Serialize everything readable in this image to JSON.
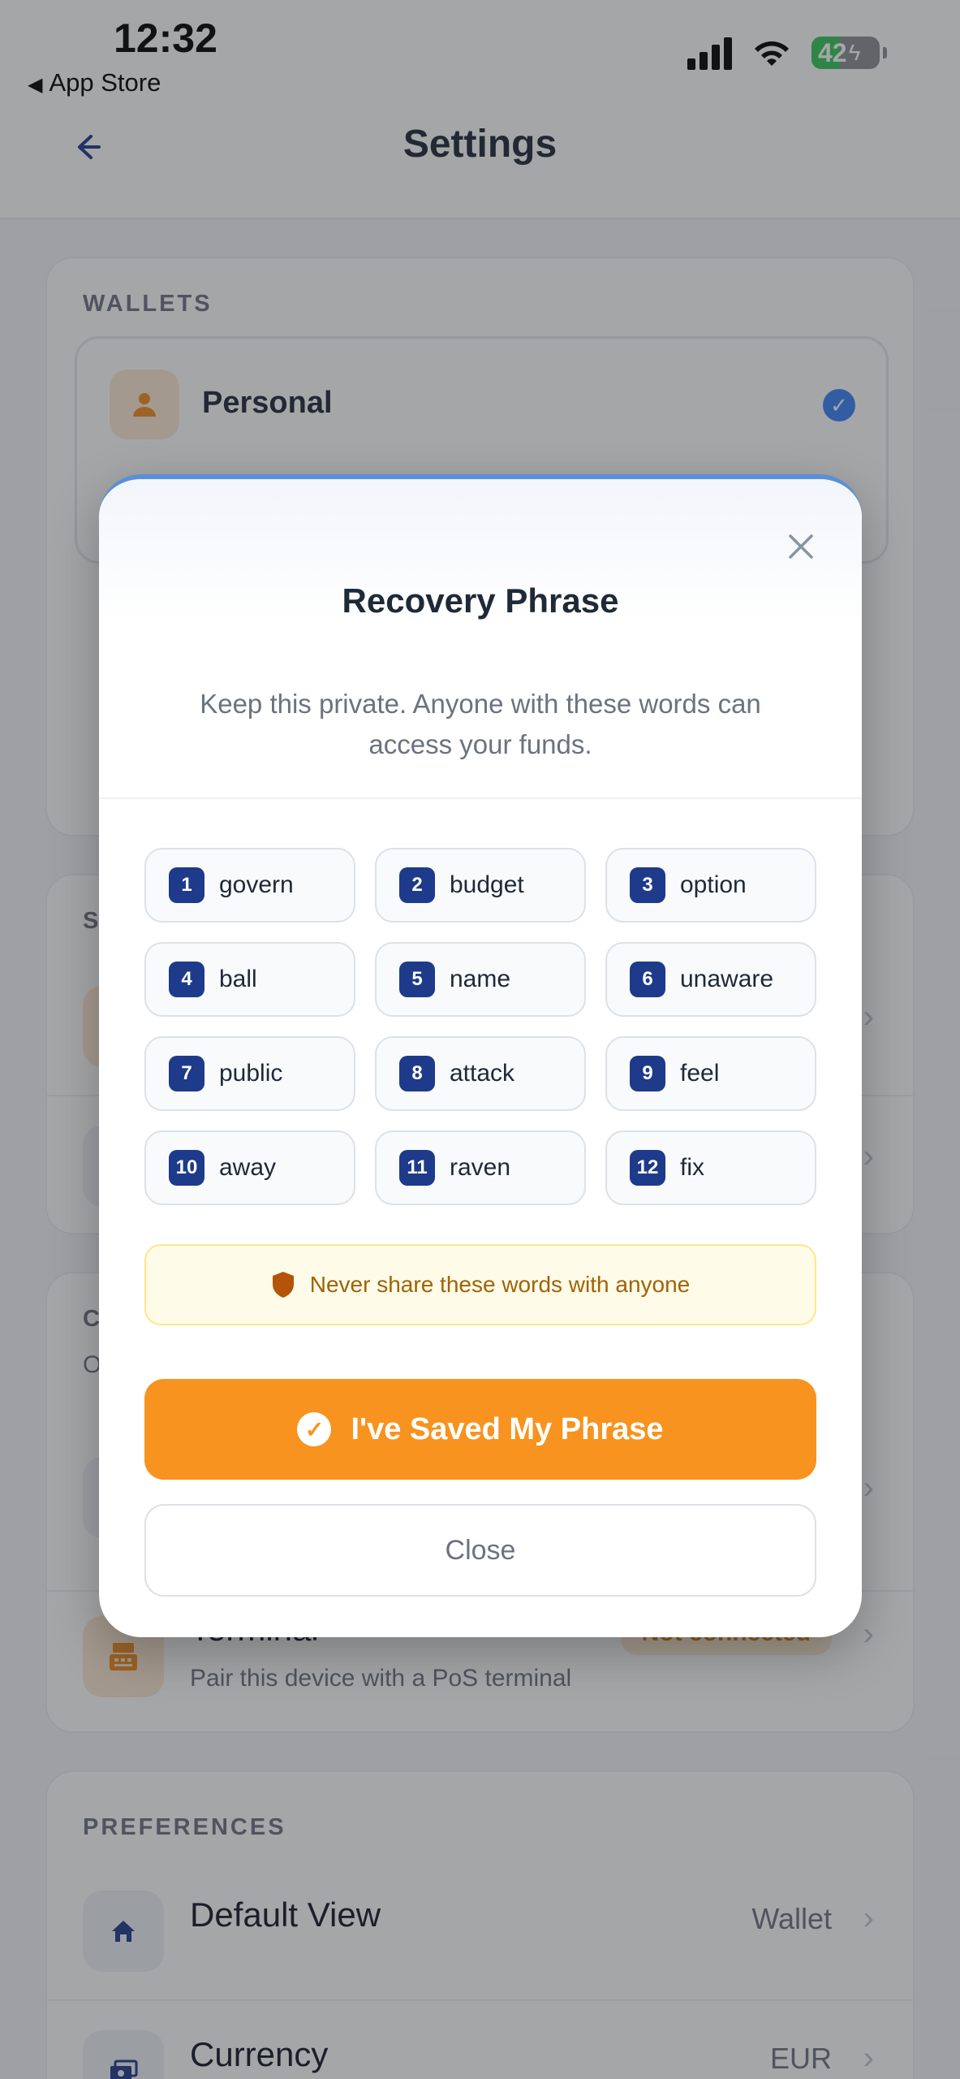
{
  "status_bar": {
    "time": "12:32",
    "back_app": "App Store",
    "battery": "42"
  },
  "header": {
    "title": "Settings"
  },
  "wallets": {
    "section": "WALLETS",
    "active_wallet": "Personal"
  },
  "obscured_labels": {
    "section2": "S",
    "section3": "C",
    "section3_sub": "O"
  },
  "terminal": {
    "title": "Terminal",
    "subtitle": "Pair this device with a PoS terminal",
    "status": "Not connected"
  },
  "preferences": {
    "section": "PREFERENCES",
    "items": [
      {
        "label": "Default View",
        "value": "Wallet"
      },
      {
        "label": "Currency",
        "value": "EUR"
      }
    ]
  },
  "modal": {
    "title": "Recovery Phrase",
    "description": "Keep this private. Anyone with these words can access your funds.",
    "words": [
      {
        "n": "1",
        "w": "govern"
      },
      {
        "n": "2",
        "w": "budget"
      },
      {
        "n": "3",
        "w": "option"
      },
      {
        "n": "4",
        "w": "ball"
      },
      {
        "n": "5",
        "w": "name"
      },
      {
        "n": "6",
        "w": "unaware"
      },
      {
        "n": "7",
        "w": "public"
      },
      {
        "n": "8",
        "w": "attack"
      },
      {
        "n": "9",
        "w": "feel"
      },
      {
        "n": "10",
        "w": "away"
      },
      {
        "n": "11",
        "w": "raven"
      },
      {
        "n": "12",
        "w": "fix"
      }
    ],
    "warning": "Never share these words with anyone",
    "primary_button": "I've Saved My Phrase",
    "secondary_button": "Close"
  },
  "colors": {
    "accent": "#f7931e",
    "navy": "#1e3a8a",
    "warning_bg": "#fefce8"
  }
}
